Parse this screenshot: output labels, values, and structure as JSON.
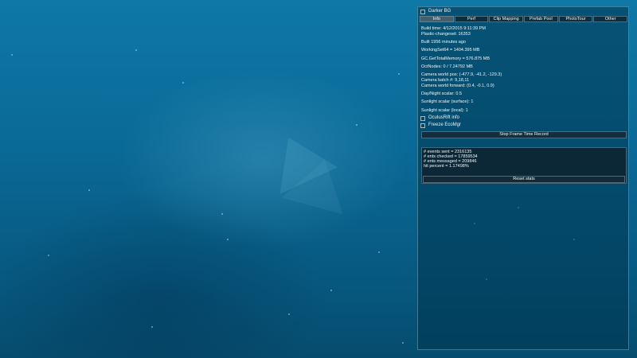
{
  "panel": {
    "darker_bg_label": "Darker BG",
    "tabs": [
      {
        "label": "Info",
        "active": true
      },
      {
        "label": "Perf",
        "active": false
      },
      {
        "label": "Clip Mapping",
        "active": false
      },
      {
        "label": "Prefab Pool",
        "active": false
      },
      {
        "label": "PhotoTour",
        "active": false
      },
      {
        "label": "Other",
        "active": false
      }
    ],
    "info": {
      "build_time": "Build time: 4/12/2015 9:11:39 PM",
      "plastic_changeset": "Plastic-changeset: 16353",
      "built_ago": "Built 1956 minutes ago",
      "working_set": "WorkingSet64 = 1404.395 MB",
      "gc_memory": "GC.GetTotalMemory = 576.875 MB",
      "oct_nodes": "OctNodes: 0 / 7.24792 MB",
      "camera_pos": "Camera world pos: (-477.9, -41.2, -129.3)",
      "camera_batch": "Camera batch #: 9,18,11",
      "camera_forward": "Camera world forward: (0.4, -0.1, 0.9)",
      "day_night": "Day/Night scalar: 0.5",
      "sunlight_surface": "Sunlight scalar (surface): 1",
      "sunlight_local": "Sunlight scalar (local): 1"
    },
    "oculus_label": "OculusRift info",
    "freeze_label": "Freeze EcoMgr",
    "stop_record_label": "Stop Frame Time Record",
    "stats": {
      "events_sent": "# events sent = 2316135",
      "ents_checked": "# ents checked = 17859534",
      "ents_messaged": "# ents messaged = 209846",
      "hit_percent": "hit percent = 1.17498%"
    },
    "reset_label": "Reset stats"
  }
}
